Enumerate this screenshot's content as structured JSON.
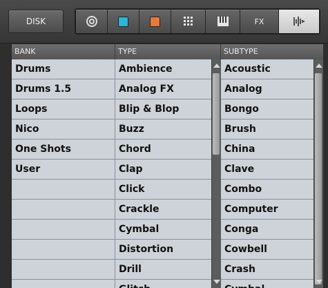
{
  "toolbar": {
    "disk_label": "DISK",
    "fx_label": "FX",
    "icons": [
      "loop-icon",
      "cyan-square-icon",
      "orange-square-icon",
      "grid-icon",
      "keyboard-icon",
      "fx",
      "waveform-icon"
    ],
    "colors": {
      "cyan": "#2bb7d6",
      "orange": "#e27b3c"
    }
  },
  "columns": {
    "bank": {
      "header": "BANK",
      "items": [
        "Drums",
        "Drums 1.5",
        "Loops",
        "Nico",
        "One Shots",
        "User",
        "",
        "",
        "",
        "",
        "",
        ""
      ]
    },
    "type": {
      "header": "TYPE",
      "items": [
        "Ambience",
        "Analog FX",
        "Blip & Blop",
        "Buzz",
        "Chord",
        "Clap",
        "Click",
        "Crackle",
        "Cymbal",
        "Distortion",
        "Drill",
        "Glitch"
      ]
    },
    "subtype": {
      "header": "SUBTYPE",
      "items": [
        "Acoustic",
        "Analog",
        "Bongo",
        "Brush",
        "China",
        "Clave",
        "Combo",
        "Computer",
        "Conga",
        "Cowbell",
        "Crash",
        "Cymbal"
      ]
    }
  }
}
